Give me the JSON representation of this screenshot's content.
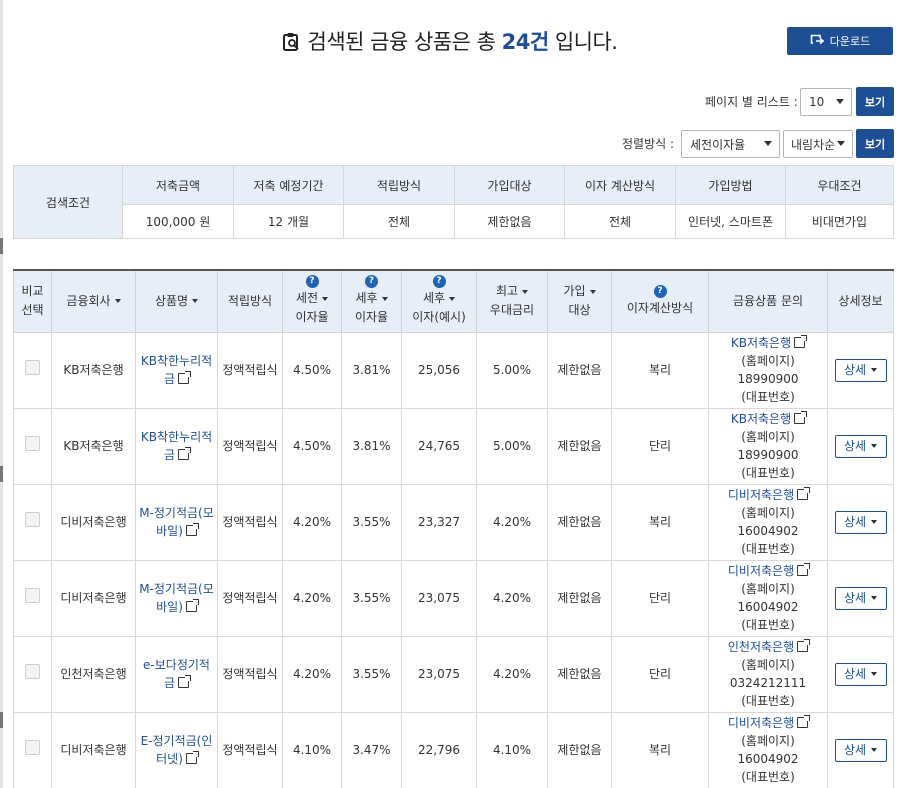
{
  "header": {
    "title_pre": "검색된 금융 상품은 총",
    "count": "24건",
    "title_post": "입니다.",
    "download_label": "다운로드"
  },
  "controls": {
    "page_list_label": "페이지 별 리스트 :",
    "page_size_value": "10",
    "view_label": "보기",
    "sort_label": "정렬방식 :",
    "sort_field_value": "세전이자율",
    "sort_order_value": "내림차순"
  },
  "conditions": {
    "label": "검색조건",
    "headers": [
      "저축금액",
      "저축 예정기간",
      "적립방식",
      "가입대상",
      "이자 계산방식",
      "가입방법",
      "우대조건"
    ],
    "values": [
      "100,000 원",
      "12 개월",
      "전체",
      "제한없음",
      "전체",
      "인터넷, 스마트폰",
      "비대면가입"
    ]
  },
  "results": {
    "headers": {
      "compare_1": "비교",
      "compare_2": "선택",
      "company": "금융회사",
      "product": "상품명",
      "method": "적립방식",
      "pretax_1": "세전",
      "pretax_2": "이자율",
      "posttax_1": "세후",
      "posttax_2": "이자율",
      "interest_1": "세후",
      "interest_2": "이자(예시)",
      "max_1": "최고",
      "max_2": "우대금리",
      "target_1": "가입",
      "target_2": "대상",
      "calc": "이자계산방식",
      "inquiry": "금융상품 문의",
      "info": "상세정보"
    },
    "rows": [
      {
        "company": "KB저축은행",
        "product": "KB착한누리적금",
        "method": "정액적립식",
        "pretax": "4.50%",
        "posttax": "3.81%",
        "interest": "25,056",
        "max_rate": "5.00%",
        "target": "제한없음",
        "calc": "복리",
        "inq_name": "KB저축은행",
        "inq_home": "(홈페이지)",
        "inq_phone": "18990900",
        "inq_rep": "(대표번호)",
        "detail": "상세"
      },
      {
        "company": "KB저축은행",
        "product": "KB착한누리적금",
        "method": "정액적립식",
        "pretax": "4.50%",
        "posttax": "3.81%",
        "interest": "24,765",
        "max_rate": "5.00%",
        "target": "제한없음",
        "calc": "단리",
        "inq_name": "KB저축은행",
        "inq_home": "(홈페이지)",
        "inq_phone": "18990900",
        "inq_rep": "(대표번호)",
        "detail": "상세"
      },
      {
        "company": "디비저축은행",
        "product": "M-정기적금(모바일)",
        "method": "정액적립식",
        "pretax": "4.20%",
        "posttax": "3.55%",
        "interest": "23,327",
        "max_rate": "4.20%",
        "target": "제한없음",
        "calc": "복리",
        "inq_name": "디비저축은행",
        "inq_home": "(홈페이지)",
        "inq_phone": "16004902",
        "inq_rep": "(대표번호)",
        "detail": "상세"
      },
      {
        "company": "디비저축은행",
        "product": "M-정기적금(모바일)",
        "method": "정액적립식",
        "pretax": "4.20%",
        "posttax": "3.55%",
        "interest": "23,075",
        "max_rate": "4.20%",
        "target": "제한없음",
        "calc": "단리",
        "inq_name": "디비저축은행",
        "inq_home": "(홈페이지)",
        "inq_phone": "16004902",
        "inq_rep": "(대표번호)",
        "detail": "상세"
      },
      {
        "company": "인천저축은행",
        "product": "e-보다정기적금",
        "method": "정액적립식",
        "pretax": "4.20%",
        "posttax": "3.55%",
        "interest": "23,075",
        "max_rate": "4.20%",
        "target": "제한없음",
        "calc": "단리",
        "inq_name": "인천저축은행",
        "inq_home": "(홈페이지)",
        "inq_phone": "0324212111",
        "inq_rep": "(대표번호)",
        "detail": "상세"
      },
      {
        "company": "디비저축은행",
        "product": "E-정기적금(인터넷)",
        "method": "정액적립식",
        "pretax": "4.10%",
        "posttax": "3.47%",
        "interest": "22,796",
        "max_rate": "4.10%",
        "target": "제한없음",
        "calc": "복리",
        "inq_name": "디비저축은행",
        "inq_home": "(홈페이지)",
        "inq_phone": "16004902",
        "inq_rep": "(대표번호)",
        "detail": "상세"
      }
    ]
  },
  "icons": {
    "title_icon": "search-document-icon",
    "download_icon": "download-icon",
    "help_icon": "question-icon",
    "external_icon": "external-link-icon"
  },
  "colors": {
    "brand": "#1e4e94",
    "header_bg": "#e7eef8",
    "link": "#1f4e96"
  }
}
